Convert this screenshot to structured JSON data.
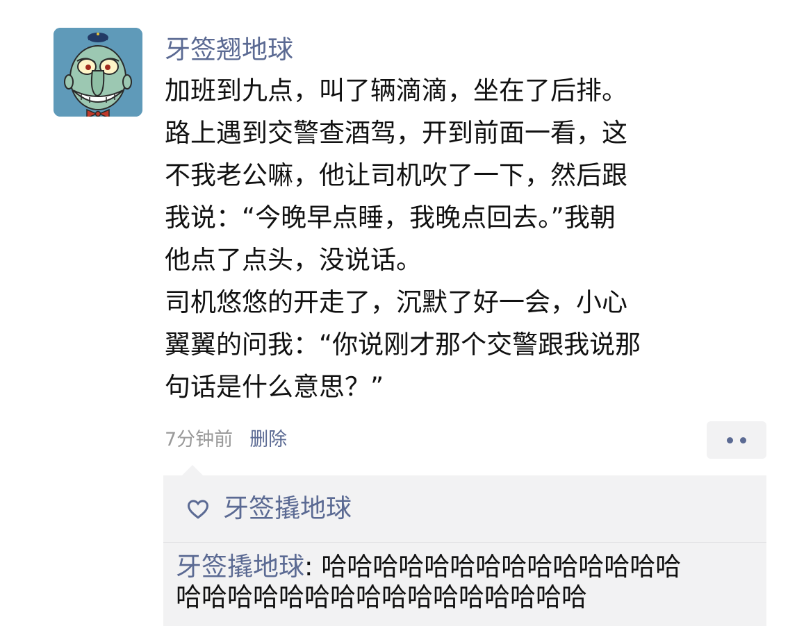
{
  "post": {
    "author": "牙签翘地球",
    "lines": [
      "加班到九点，叫了辆滴滴，坐在了后排。",
      "路上遇到交警查酒驾，开到前面一看，这",
      "不我老公嘛，他让司机吹了一下，然后跟",
      "我说：“今晚早点睡，我晚点回去。”我朝",
      "他点了点头，没说话。",
      "司机悠悠的开走了，沉默了好一会，小心",
      "翼翼的问我：“你说刚才那个交警跟我说那",
      "句话是什么意思？”"
    ],
    "time": "7分钟前",
    "delete_label": "删除",
    "more_icon": "more-dots-icon"
  },
  "likes": {
    "icon": "heart-outline-icon",
    "users": "牙签撬地球"
  },
  "comments": [
    {
      "user": "牙签撬地球",
      "separator": ": ",
      "line1": "哈哈哈哈哈哈哈哈哈哈哈哈哈哈",
      "line2": "哈哈哈哈哈哈哈哈哈哈哈哈哈哈哈哈"
    }
  ],
  "colors": {
    "link": "#5b6a93",
    "text": "#111111",
    "meta": "#999999",
    "panel": "#f2f2f3",
    "avatar_bg": "#5f9ab9"
  }
}
